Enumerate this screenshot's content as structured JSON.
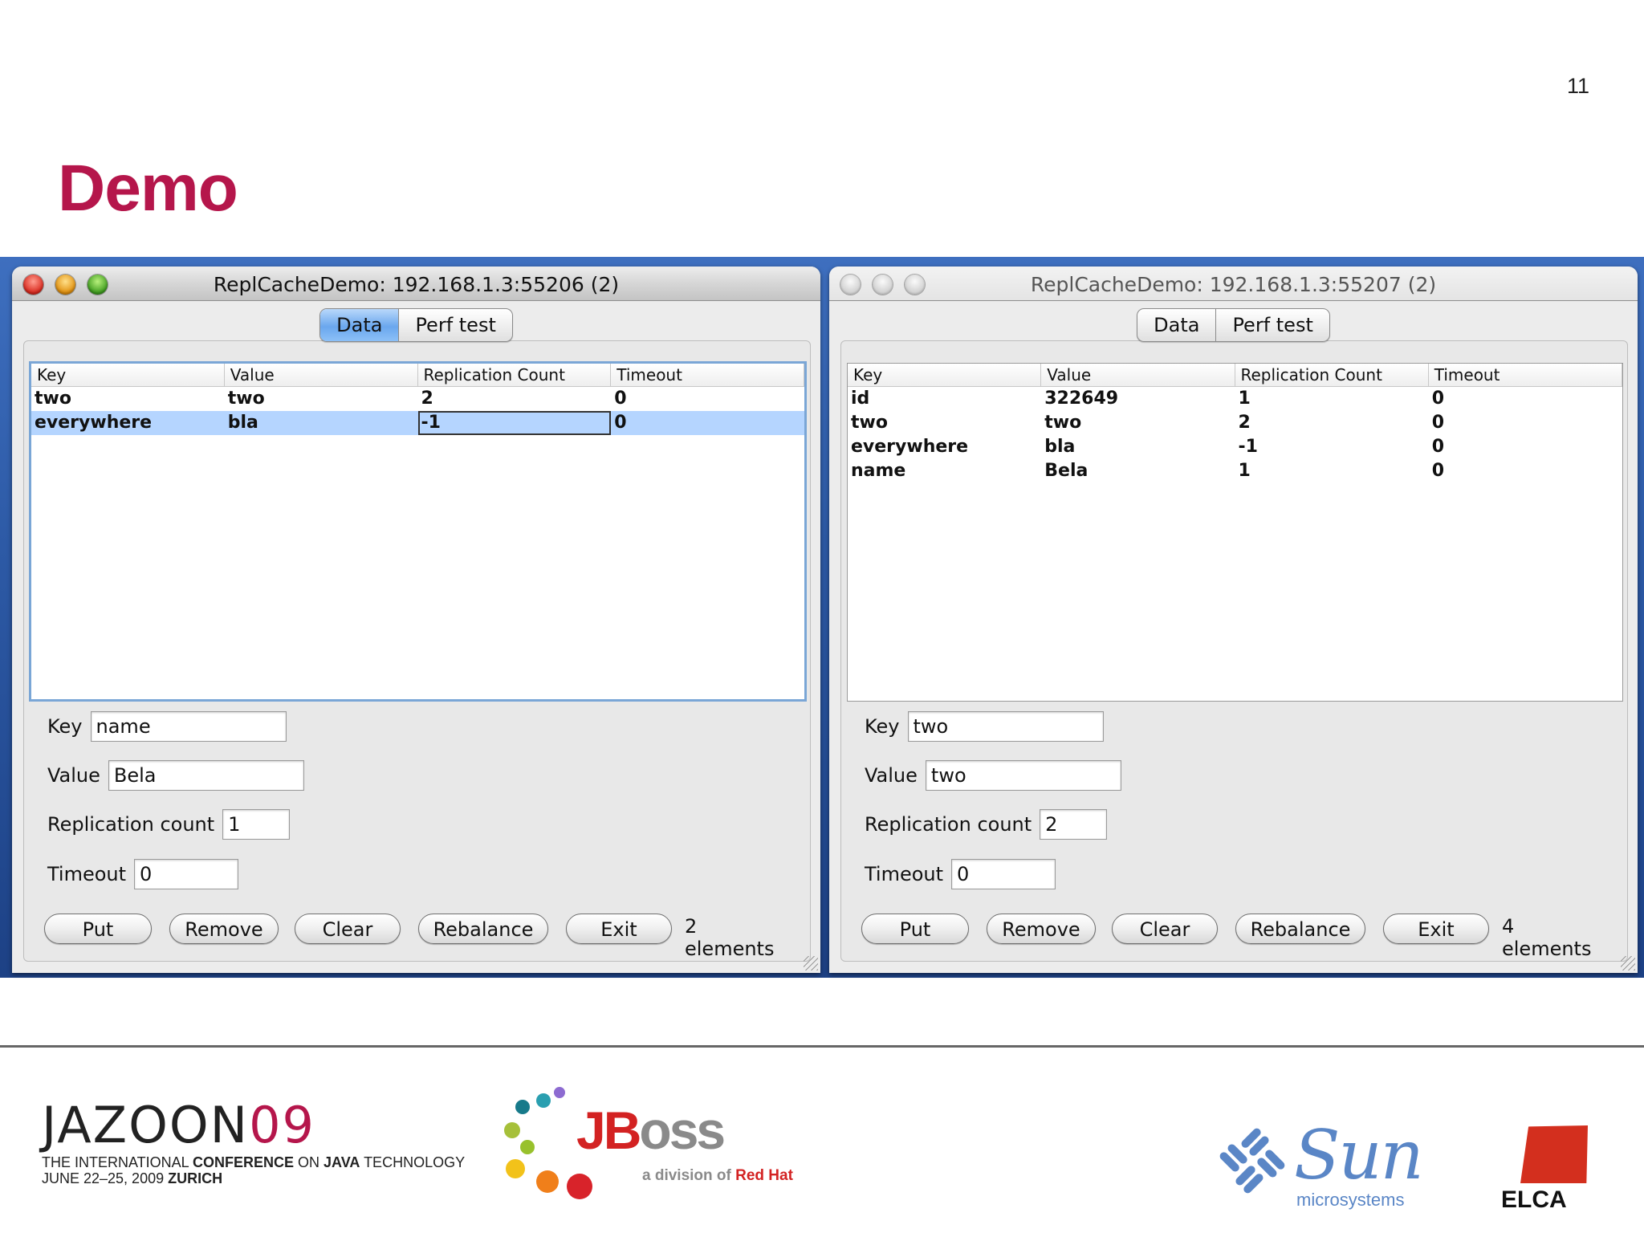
{
  "slide": {
    "number": "11",
    "title": "Demo"
  },
  "windows": [
    {
      "title": "ReplCacheDemo: 192.168.1.3:55206 (2)",
      "active": true,
      "tabs": [
        "Data",
        "Perf test"
      ],
      "active_tab": "Data",
      "table": {
        "columns": [
          "Key",
          "Value",
          "Replication Count",
          "Timeout"
        ],
        "rows": [
          [
            "two",
            "two",
            "2",
            "0"
          ],
          [
            "everywhere",
            "bla",
            "-1",
            "0"
          ]
        ],
        "selected_row": 1
      },
      "form": {
        "key_label": "Key",
        "key_value": "name",
        "value_label": "Value",
        "value_value": "Bela",
        "replication_label": "Replication count",
        "replication_value": "1",
        "timeout_label": "Timeout",
        "timeout_value": "0"
      },
      "buttons": [
        "Put",
        "Remove",
        "Clear",
        "Rebalance",
        "Exit"
      ],
      "element_count": "2 elements"
    },
    {
      "title": "ReplCacheDemo: 192.168.1.3:55207 (2)",
      "active": false,
      "tabs": [
        "Data",
        "Perf test"
      ],
      "active_tab": "Data",
      "table": {
        "columns": [
          "Key",
          "Value",
          "Replication Count",
          "Timeout"
        ],
        "rows": [
          [
            "id",
            "322649",
            "1",
            "0"
          ],
          [
            "two",
            "two",
            "2",
            "0"
          ],
          [
            "everywhere",
            "bla",
            "-1",
            "0"
          ],
          [
            "name",
            "Bela",
            "1",
            "0"
          ]
        ],
        "selected_row": null
      },
      "form": {
        "key_label": "Key",
        "key_value": "two",
        "value_label": "Value",
        "value_value": "two",
        "replication_label": "Replication count",
        "replication_value": "2",
        "timeout_label": "Timeout",
        "timeout_value": "0"
      },
      "buttons": [
        "Put",
        "Remove",
        "Clear",
        "Rebalance",
        "Exit"
      ],
      "element_count": "4 elements"
    }
  ],
  "footer": {
    "jazoon": {
      "word": "JAZOON",
      "year": "09",
      "line1_a": "THE INTERNATIONAL ",
      "line1_b": "CONFERENCE",
      "line1_c": " ON ",
      "line1_d": "JAVA",
      "line1_e": " TECHNOLOGY",
      "line2_a": "JUNE 22–25, 2009 ",
      "line2_b": "ZURICH"
    },
    "jboss": {
      "j": "JB",
      "oss": "oss",
      "sub_a": "a division of ",
      "sub_b": "Red Hat"
    },
    "sun": {
      "word": "Sun",
      "sub": "microsystems"
    },
    "elca": {
      "word": "ELCA"
    }
  }
}
